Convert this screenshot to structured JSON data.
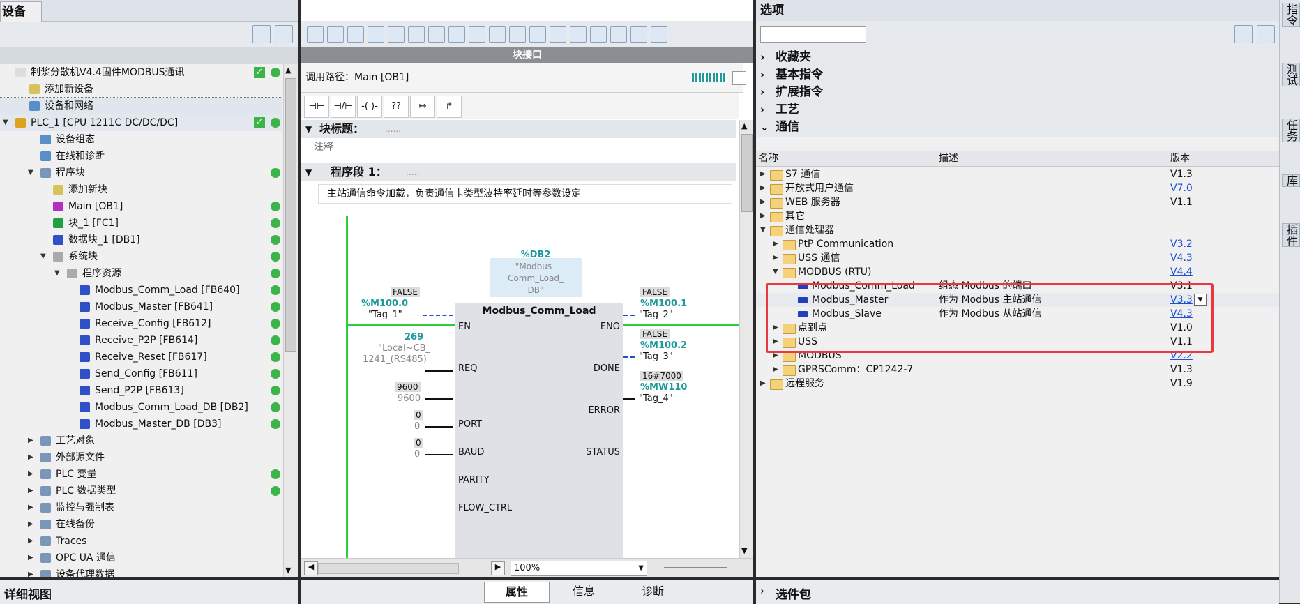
{
  "left": {
    "tab_title": "设备",
    "tree": [
      {
        "label": "制浆分散机V4.4固件MODBUS通讯",
        "check": true
      },
      {
        "label": "添加新设备"
      },
      {
        "label": "设备和网络"
      },
      {
        "label": "PLC_1 [CPU 1211C DC/DC/DC]",
        "check": true
      },
      {
        "label": "设备组态"
      },
      {
        "label": "在线和诊断"
      },
      {
        "label": "程序块"
      },
      {
        "label": "添加新块"
      },
      {
        "label": "Main [OB1]"
      },
      {
        "label": "块_1 [FC1]"
      },
      {
        "label": "数据块_1 [DB1]"
      },
      {
        "label": "系统块"
      },
      {
        "label": "程序资源"
      },
      {
        "label": "Modbus_Comm_Load [FB640]"
      },
      {
        "label": "Modbus_Master [FB641]"
      },
      {
        "label": "Receive_Config [FB612]"
      },
      {
        "label": "Receive_P2P [FB614]"
      },
      {
        "label": "Receive_Reset [FB617]"
      },
      {
        "label": "Send_Config [FB611]"
      },
      {
        "label": "Send_P2P [FB613]"
      },
      {
        "label": "Modbus_Comm_Load_DB [DB2]"
      },
      {
        "label": "Modbus_Master_DB [DB3]"
      },
      {
        "label": "工艺对象"
      },
      {
        "label": "外部源文件"
      },
      {
        "label": "PLC 变量"
      },
      {
        "label": "PLC 数据类型"
      },
      {
        "label": "监控与强制表"
      },
      {
        "label": "在线备份"
      },
      {
        "label": "Traces"
      },
      {
        "label": "OPC UA 通信"
      },
      {
        "label": "设备代理数据"
      }
    ],
    "detail_view": "详细视图"
  },
  "middle": {
    "header": "块接口",
    "call_path": "调用路径：Main [OB1]",
    "block_title": "块标题：",
    "block_title_dots": "......",
    "comment": "注释",
    "network_title": "程序段 1：",
    "network_dots": ".....",
    "network_comment": "主站通信命令加载，负责通信卡类型波特率延时等参数设定",
    "db_addr": "%DB2",
    "db_name": "\"Modbus_\nComm_Load_\nDB\"",
    "fb_name": "Modbus_Comm_Load",
    "pins_in": [
      "EN",
      "REQ",
      "PORT",
      "BAUD",
      "PARITY",
      "FLOW_CTRL"
    ],
    "pins_out": [
      "ENO",
      "DONE",
      "ERROR",
      "STATUS"
    ],
    "req_val": "FALSE",
    "req_addr": "%M100.0",
    "req_tag": "\"Tag_1\"",
    "port_val": "269",
    "port_tag1": "\"Local~CB_",
    "port_tag2": "1241_(RS485)",
    "baud_val": "9600",
    "baud_val2": "9600",
    "parity_val": "0",
    "parity_val2": "0",
    "flow_val": "0",
    "flow_val2": "0",
    "done_val": "FALSE",
    "done_addr": "%M100.1",
    "done_tag": "\"Tag_2\"",
    "error_val": "FALSE",
    "error_addr": "%M100.2",
    "error_tag": "\"Tag_3\"",
    "status_val": "16#7000",
    "status_addr": "%MW110",
    "status_tag": "\"Tag_4\"",
    "zoom": "100%",
    "tabs": {
      "properties": "属性",
      "info": "信息",
      "diagnostics": "诊断"
    }
  },
  "right": {
    "title": "选项",
    "categories": [
      "收藏夹",
      "基本指令",
      "扩展指令",
      "工艺",
      "通信"
    ],
    "columns": {
      "name": "名称",
      "desc": "描述",
      "version": "版本"
    },
    "rows": [
      {
        "name": "S7 通信",
        "desc": "",
        "ver": "V1.3"
      },
      {
        "name": "开放式用户通信",
        "desc": "",
        "ver": "V7.0"
      },
      {
        "name": "WEB 服务器",
        "desc": "",
        "ver": "V1.1"
      },
      {
        "name": "其它",
        "desc": "",
        "ver": ""
      },
      {
        "name": "通信处理器",
        "desc": "",
        "ver": ""
      },
      {
        "name": "PtP Communication",
        "desc": "",
        "ver": "V3.2"
      },
      {
        "name": "USS 通信",
        "desc": "",
        "ver": "V4.3"
      },
      {
        "name": "MODBUS (RTU)",
        "desc": "",
        "ver": "V4.4"
      },
      {
        "name": "Modbus_Comm_Load",
        "desc": "组态 Modbus 的端口",
        "ver": "V3.1"
      },
      {
        "name": "Modbus_Master",
        "desc": "作为 Modbus 主站通信",
        "ver": "V3.3"
      },
      {
        "name": "Modbus_Slave",
        "desc": "作为 Modbus 从站通信",
        "ver": "V4.3"
      },
      {
        "name": "点到点",
        "desc": "",
        "ver": "V1.0"
      },
      {
        "name": "USS",
        "desc": "",
        "ver": "V1.1"
      },
      {
        "name": "MODBUS",
        "desc": "",
        "ver": "V2.2"
      },
      {
        "name": "GPRSComm：CP1242-7",
        "desc": "",
        "ver": "V1.3"
      },
      {
        "name": "远程服务",
        "desc": "",
        "ver": "V1.9"
      }
    ],
    "packages": "选件包"
  },
  "side_tabs": [
    "指令",
    "测试",
    "任务",
    "库",
    "插件"
  ],
  "colors": {
    "status_green": "#3bb44a",
    "highlight_red": "#e8393f",
    "link_blue": "#1a4fd6",
    "tag_teal": "#1f9a9a"
  }
}
